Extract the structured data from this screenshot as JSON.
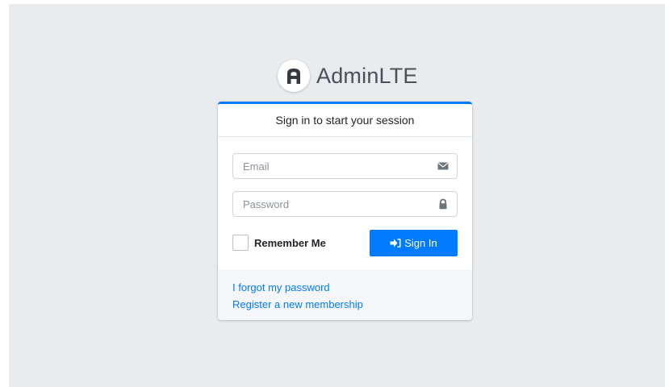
{
  "brand": {
    "bold": "Admin",
    "light": "LTE",
    "logo_icon": "adminlte-logo-icon"
  },
  "login": {
    "header": "Sign in to start your session",
    "email_placeholder": "Email",
    "email_value": "",
    "email_icon": "envelope-icon",
    "password_placeholder": "Password",
    "password_value": "",
    "password_icon": "lock-icon",
    "remember_label": "Remember Me",
    "remember_checked": false,
    "signin_label": "Sign In",
    "signin_icon": "sign-in-icon"
  },
  "links": {
    "forgot": "I forgot my password",
    "register": "Register a new membership"
  },
  "colors": {
    "primary": "#007bff",
    "background": "#e9ecef",
    "footer_bg": "#f4f6f9",
    "text": "#212529",
    "icon": "#6c757d"
  }
}
